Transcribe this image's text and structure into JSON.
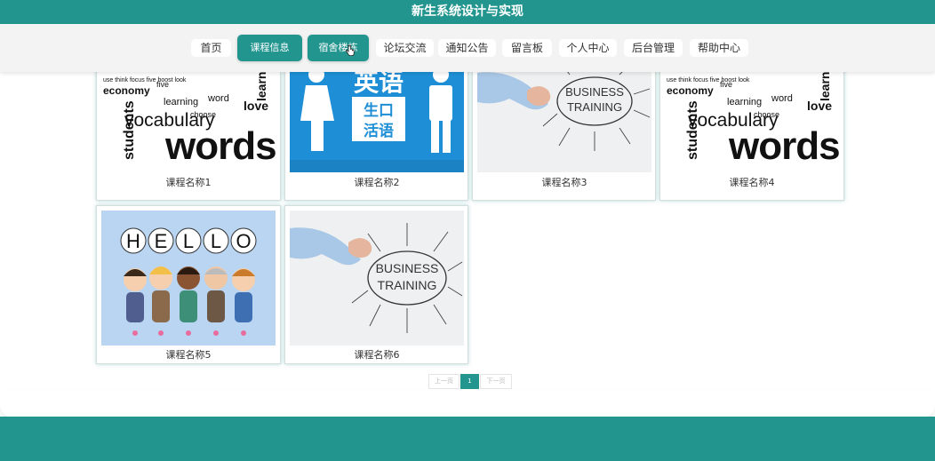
{
  "header": {
    "title": "新生系统设计与实现"
  },
  "nav": {
    "items": [
      {
        "label": "首页"
      },
      {
        "label": "课程信息"
      },
      {
        "label": "宿舍楼栋"
      },
      {
        "label": "论坛交流"
      },
      {
        "label": "通知公告"
      },
      {
        "label": "留言板"
      },
      {
        "label": "个人中心"
      },
      {
        "label": "后台管理"
      },
      {
        "label": "帮助中心"
      }
    ],
    "active_index": 1
  },
  "courses": [
    {
      "name": "课程名称1",
      "image": "vocabulary-words-collage"
    },
    {
      "name": "课程名称2",
      "image": "english-spoken-language-sign"
    },
    {
      "name": "课程名称3",
      "image": "business-training-sketch"
    },
    {
      "name": "课程名称4",
      "image": "vocabulary-words-collage"
    },
    {
      "name": "课程名称5",
      "image": "hello-cartoon-kids"
    },
    {
      "name": "课程名称6",
      "image": "business-training-sketch"
    }
  ],
  "images": {
    "english_title": "英语",
    "english_sub": "生口\n活语",
    "vocab_words": "words",
    "vocab_vocabulary": "vocabulary",
    "vocab_students": "students",
    "vocab_learn": "learn",
    "vocab_love": "love",
    "vocab_economy": "economy",
    "vocab_learning": "learning",
    "vocab_choose": "choose",
    "vocab_word": "word",
    "vocab_five": "five",
    "biz_line1": "BUSINESS",
    "biz_line2": "TRAINING",
    "hello": [
      "H",
      "E",
      "L",
      "L",
      "O"
    ]
  },
  "pagination": {
    "prev": "上一页",
    "current": "1",
    "next": "下一页"
  },
  "colors": {
    "brand": "#22958f",
    "nav_bg": "#f3f3f3",
    "english_bg": "#1e8fd6"
  }
}
